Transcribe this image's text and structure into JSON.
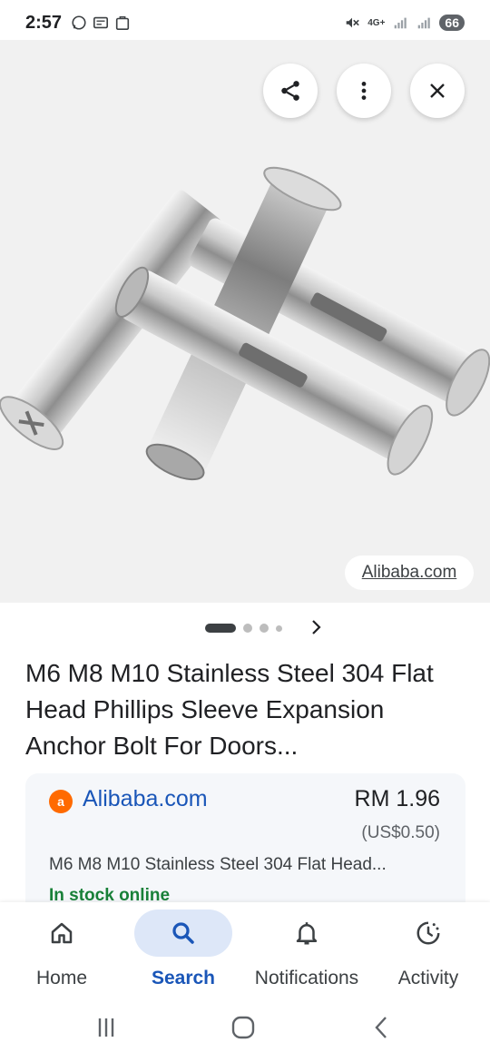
{
  "status": {
    "time": "2:57",
    "network": "4G+",
    "battery": "66"
  },
  "image_viewer": {
    "source_label": "Alibaba.com",
    "pager": {
      "total": 4,
      "active": 1
    }
  },
  "product": {
    "title": "M6 M8 M10 Stainless Steel 304 Flat Head Phillips Sleeve Expansion Anchor Bolt For Doors..."
  },
  "offer": {
    "merchant": "Alibaba.com",
    "price": "RM 1.96",
    "price_usd": "(US$0.50)",
    "description": "M6 M8 M10 Stainless Steel 304 Flat Head...",
    "stock": "In stock online"
  },
  "bottom_nav": {
    "items": [
      {
        "label": "Home",
        "icon": "home-icon"
      },
      {
        "label": "Search",
        "icon": "search-icon"
      },
      {
        "label": "Notifications",
        "icon": "bell-icon"
      },
      {
        "label": "Activity",
        "icon": "activity-icon"
      }
    ],
    "active": "Search"
  },
  "colors": {
    "accent": "#1a56b8",
    "stock_green": "#188038",
    "merchant_orange": "#ff6a00"
  }
}
